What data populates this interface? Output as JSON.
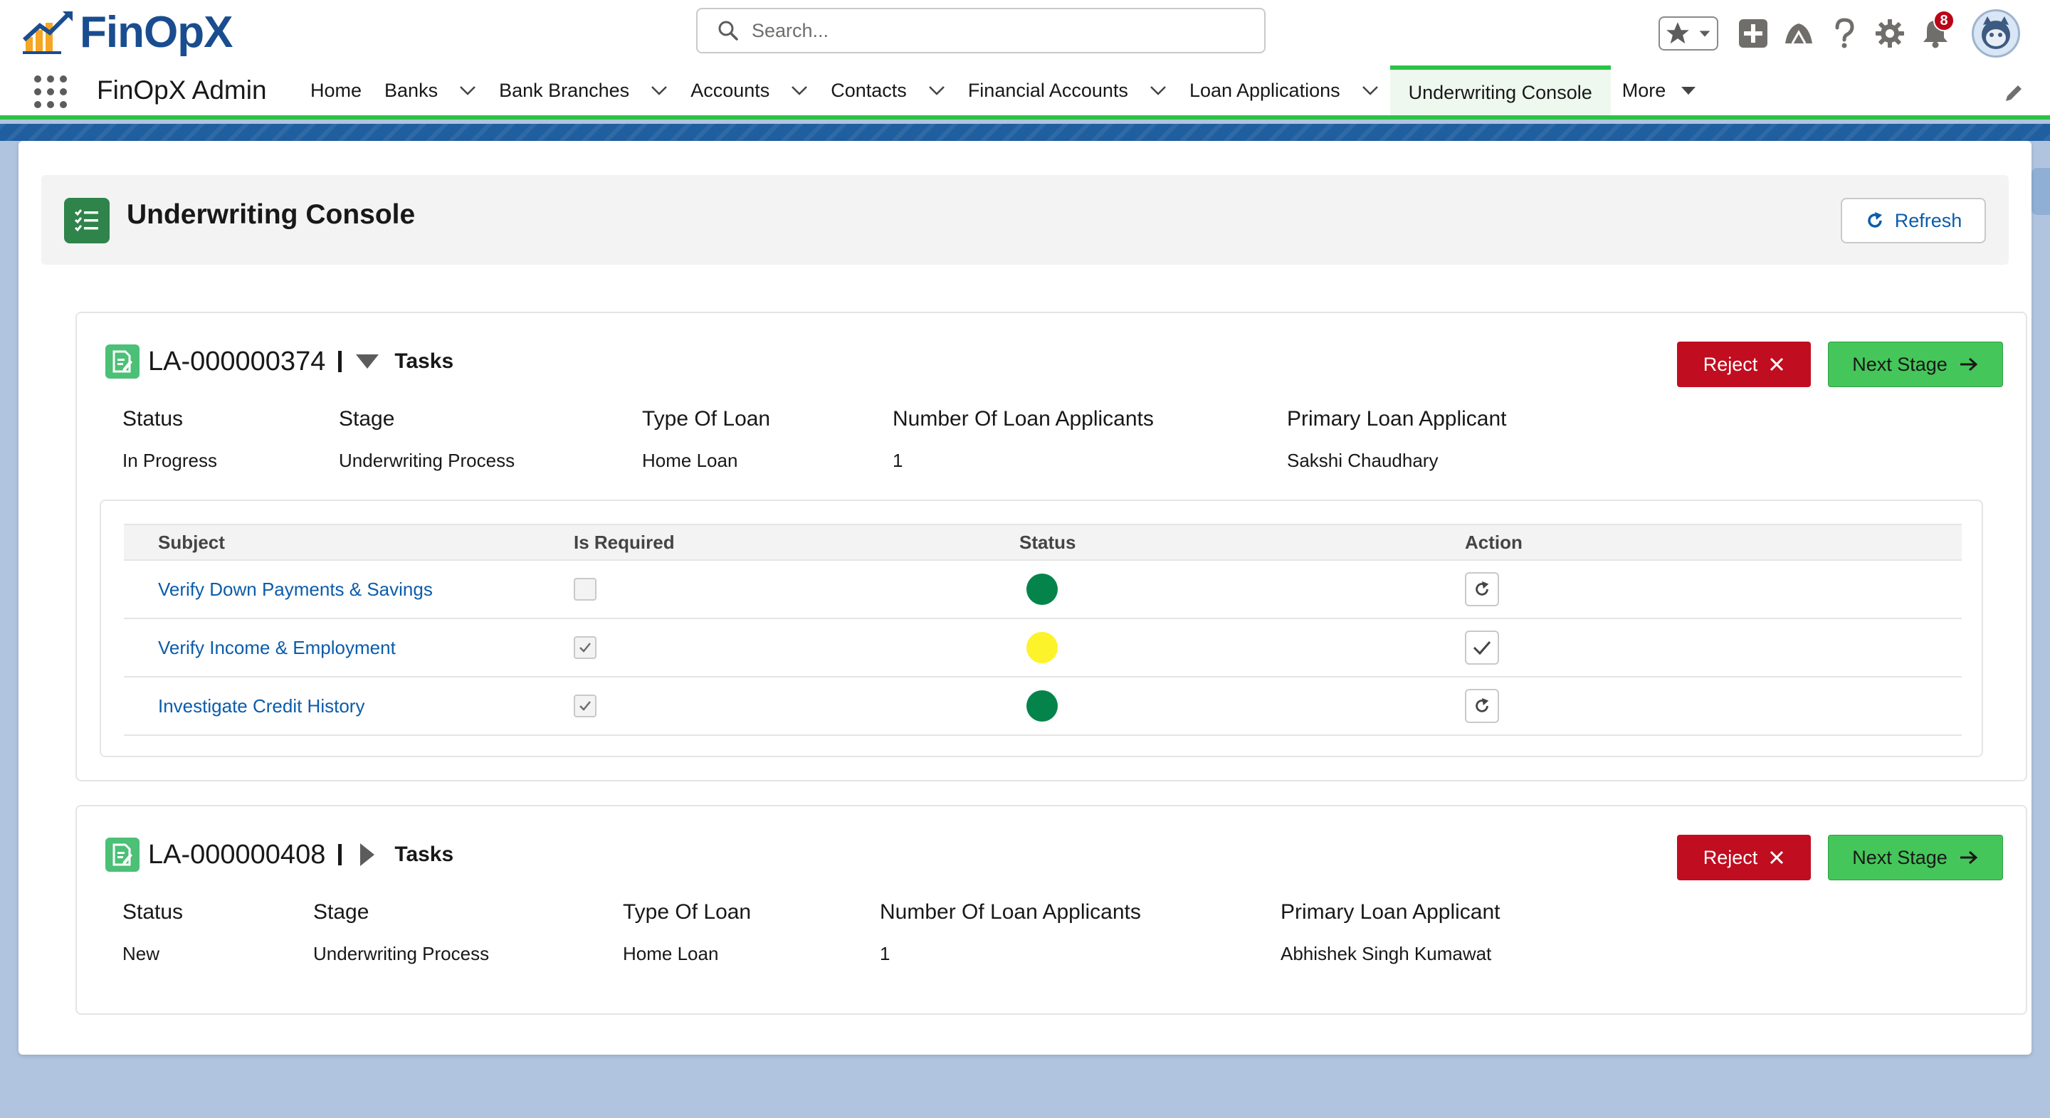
{
  "header": {
    "logo_text": "FinOpX",
    "search_placeholder": "Search...",
    "notification_count": "8"
  },
  "nav": {
    "app_name": "FinOpX Admin",
    "items": [
      {
        "label": "Home",
        "dropdown": false
      },
      {
        "label": "Banks",
        "dropdown": true
      },
      {
        "label": "Bank Branches",
        "dropdown": true
      },
      {
        "label": "Accounts",
        "dropdown": true
      },
      {
        "label": "Contacts",
        "dropdown": true
      },
      {
        "label": "Financial Accounts",
        "dropdown": true
      },
      {
        "label": "Loan Applications",
        "dropdown": true
      },
      {
        "label": "Underwriting Console",
        "dropdown": false,
        "active": true
      },
      {
        "label": "More",
        "dropdown": true
      }
    ]
  },
  "page": {
    "title": "Underwriting Console",
    "refresh_label": "Refresh"
  },
  "field_labels": {
    "status": "Status",
    "stage": "Stage",
    "type_of_loan": "Type Of Loan",
    "num_applicants": "Number Of Loan Applicants",
    "primary_applicant": "Primary Loan Applicant"
  },
  "buttons": {
    "reject": "Reject",
    "next_stage": "Next Stage",
    "tasks": "Tasks"
  },
  "applications": [
    {
      "id": "LA-000000374",
      "expanded": true,
      "status": "In Progress",
      "stage": "Underwriting Process",
      "type_of_loan": "Home Loan",
      "num_applicants": "1",
      "primary_applicant": "Sakshi Chaudhary",
      "task_columns": [
        "Subject",
        "Is Required",
        "Status",
        "Action"
      ],
      "tasks": [
        {
          "subject": "Verify Down Payments & Savings",
          "required": false,
          "status_color": "#04844b",
          "action_icon": "refresh-icon"
        },
        {
          "subject": "Verify Income & Employment",
          "required": true,
          "status_color": "#fcf32a",
          "action_icon": "check-icon"
        },
        {
          "subject": "Investigate Credit History",
          "required": true,
          "status_color": "#04844b",
          "action_icon": "refresh-icon"
        }
      ]
    },
    {
      "id": "LA-000000408",
      "expanded": false,
      "status": "New",
      "stage": "Underwriting Process",
      "type_of_loan": "Home Loan",
      "num_applicants": "1",
      "primary_applicant": "Abhishek Singh Kumawat"
    }
  ],
  "colors": {
    "brand": "#1a4d8f",
    "nav_accent": "#2bc247",
    "reject": "#c00d1f",
    "next_stage": "#45c65a",
    "link": "#0b5cab"
  }
}
